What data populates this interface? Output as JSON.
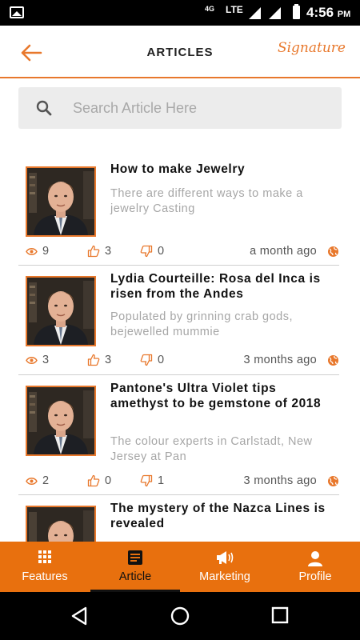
{
  "status_bar": {
    "network_label": "4G",
    "lte_label": "LTE",
    "time": "4:56",
    "ampm": "PM"
  },
  "header": {
    "title": "ARTICLES",
    "brand": "Signature"
  },
  "search": {
    "placeholder": "Search Article Here",
    "value": ""
  },
  "articles": [
    {
      "title": "How to make Jewelry",
      "description": "There are different ways to make a jewelry Casting",
      "views": "9",
      "likes": "3",
      "dislikes": "0",
      "age": "a month ago"
    },
    {
      "title": "Lydia Courteille: Rosa del Inca is risen from the Andes",
      "description": "Populated by grinning crab gods, bejewelled mummie",
      "views": "3",
      "likes": "3",
      "dislikes": "0",
      "age": "3 months ago"
    },
    {
      "title": "Pantone's Ultra Violet tips amethyst to be gemstone of 2018",
      "description": "The colour experts in Carlstadt, New Jersey at Pan",
      "views": "2",
      "likes": "0",
      "dislikes": "1",
      "age": "3 months ago"
    },
    {
      "title": "The mystery of the Nazca Lines is revealed",
      "description": "",
      "views": "",
      "likes": "",
      "dislikes": "",
      "age": ""
    }
  ],
  "bottom_nav": [
    {
      "label": "Features",
      "icon": "grid-icon",
      "active": false
    },
    {
      "label": "Article",
      "icon": "article-icon",
      "active": true
    },
    {
      "label": "Marketing",
      "icon": "megaphone-icon",
      "active": false
    },
    {
      "label": "Profile",
      "icon": "person-icon",
      "active": false
    }
  ],
  "colors": {
    "accent": "#e8782c",
    "nav_background": "#e8700e",
    "muted_text": "#a6a6a6"
  }
}
